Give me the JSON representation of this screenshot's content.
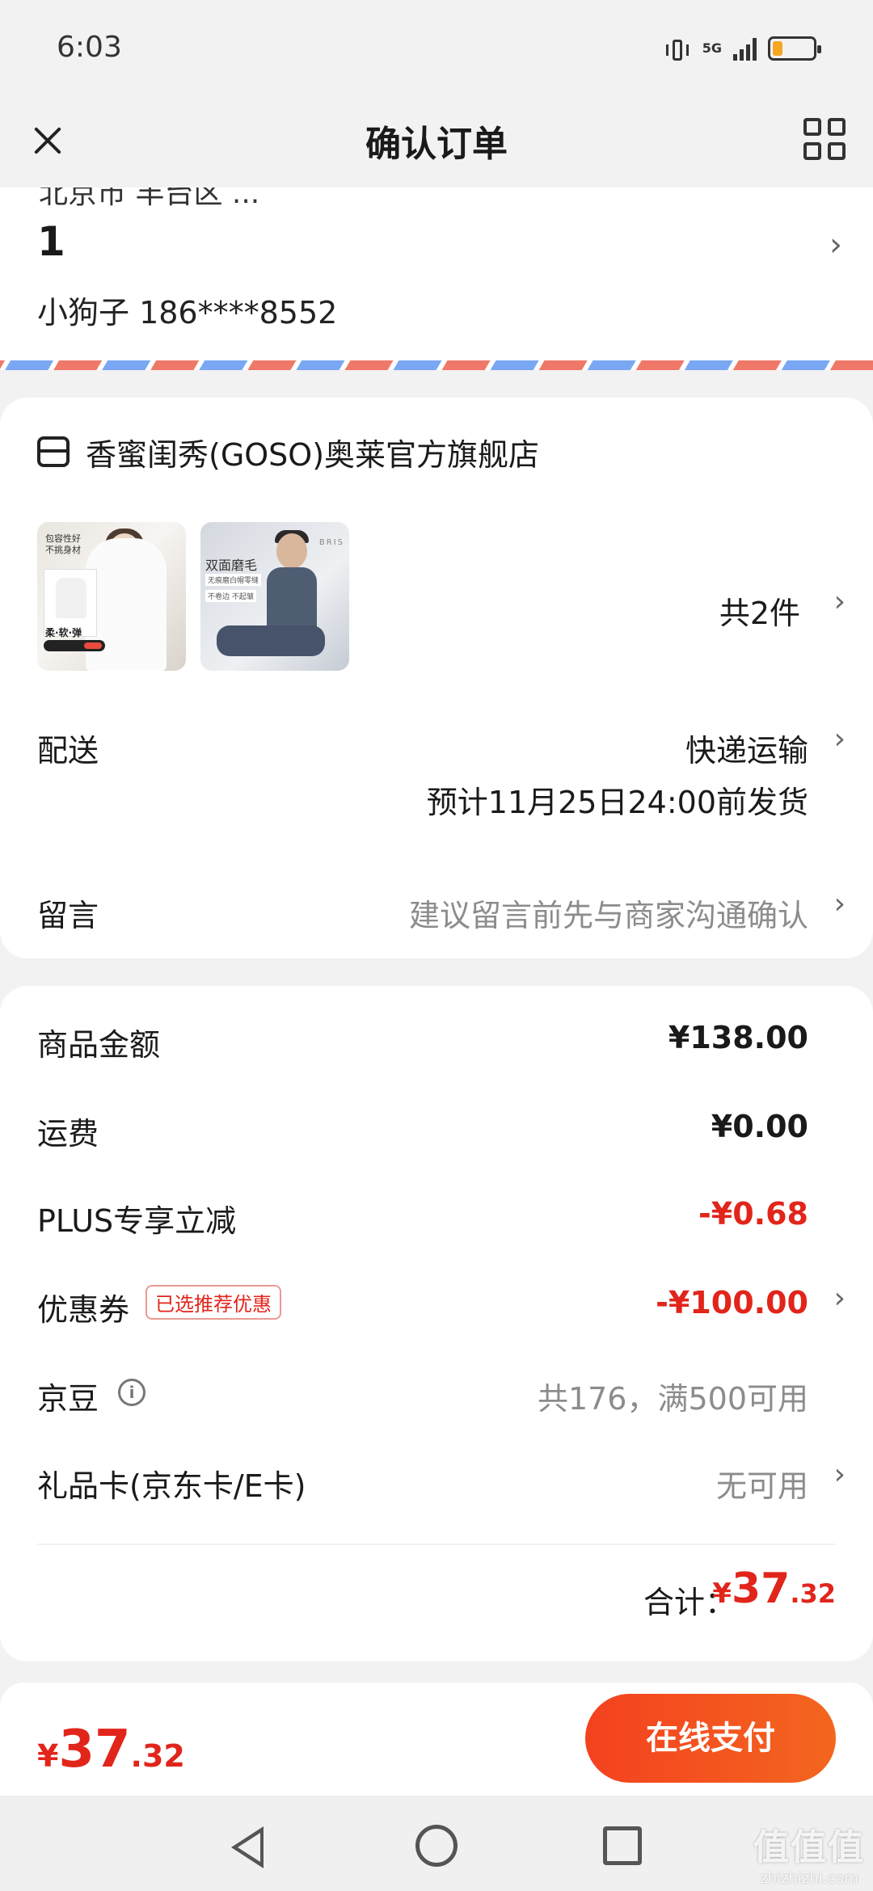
{
  "status_bar": {
    "time": "6:03",
    "network": "5G",
    "battery_level": 0.25,
    "battery_color": "#f5a623"
  },
  "header": {
    "title": "确认订单",
    "close_icon": "close-icon",
    "menu_icon": "grid-icon"
  },
  "address": {
    "cut_text": "北京市 丰台区 ...",
    "line": "1",
    "contact": "小狗子 186****8552"
  },
  "shop": {
    "name": "香蜜闺秀(GOSO)奥莱官方旗舰店",
    "item_count": "共2件",
    "thumb1": {
      "tag_line1": "包容性好",
      "tag_line2": "不挑身材",
      "tag_footer": "柔·软·弹"
    },
    "thumb2": {
      "title": "双面磨毛",
      "sub1": "无痕磨白帽零缝",
      "sub2": "不卷边 不起皱",
      "brand": "BRIS"
    }
  },
  "delivery": {
    "label": "配送",
    "method": "快递运输",
    "eta": "预计11月25日24:00前发货"
  },
  "message": {
    "label": "留言",
    "placeholder": "建议留言前先与商家沟通确认"
  },
  "pricing": {
    "goods_label": "商品金额",
    "goods_value": "¥138.00",
    "shipping_label": "运费",
    "shipping_value": "¥0.00",
    "plus_label": "PLUS专享立减",
    "plus_value": "-¥0.68",
    "coupon_label": "优惠券",
    "coupon_badge": "已选推荐优惠",
    "coupon_value": "-¥100.00",
    "beans_label": "京豆",
    "beans_value": "共176，满500可用",
    "giftcard_label": "礼品卡(京东卡/E卡)",
    "giftcard_value": "无可用",
    "total_label": "合计：",
    "total_yen": "¥",
    "total_int": "37",
    "total_dec": ".32"
  },
  "bottom": {
    "yen": "¥",
    "int": "37",
    "dec": ".32",
    "pay_label": "在线支付"
  },
  "watermark": {
    "main": "值值值",
    "sub": "zhizhizhi.com"
  },
  "colors": {
    "accent": "#e1251b",
    "pay_button": "#f4411f"
  }
}
